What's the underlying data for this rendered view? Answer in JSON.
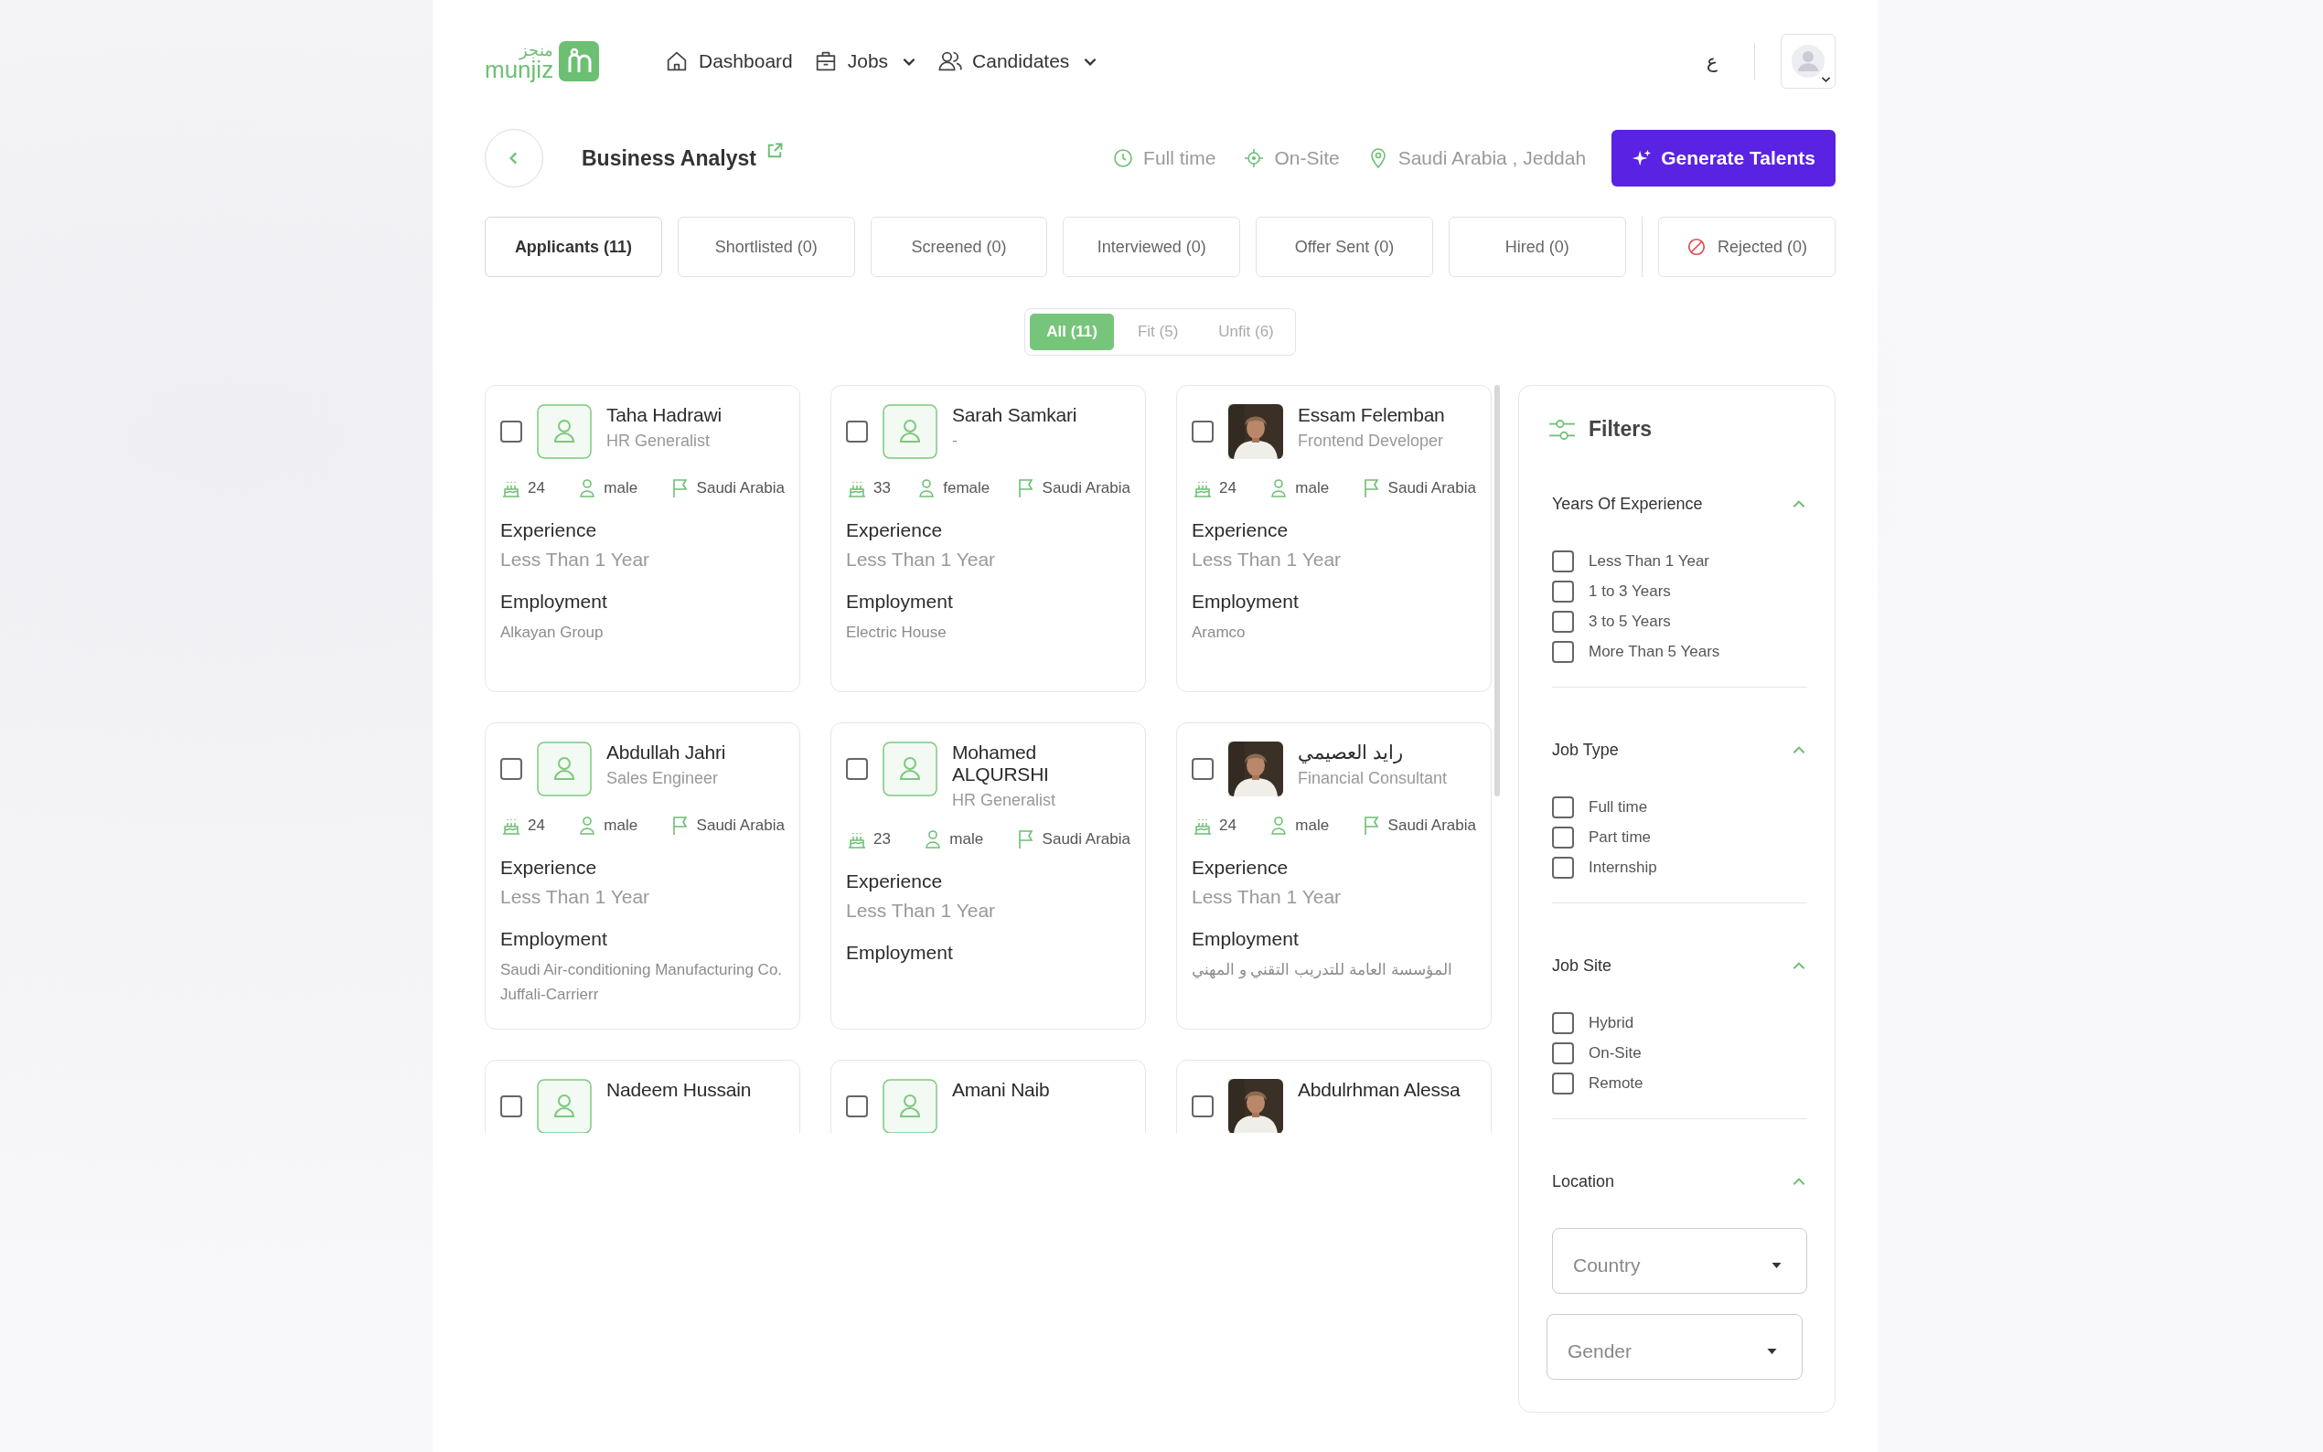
{
  "logo": {
    "wordmark": "munjiz",
    "arabic_wordmark": "منجز"
  },
  "nav": [
    {
      "label": "Dashboard",
      "kind": "home",
      "dropdown": false
    },
    {
      "label": "Jobs",
      "kind": "briefcase",
      "dropdown": true
    },
    {
      "label": "Candidates",
      "kind": "users",
      "dropdown": true
    }
  ],
  "language_toggle": "ع",
  "job": {
    "title": "Business Analyst",
    "meta": [
      {
        "kind": "clock",
        "text": "Full time"
      },
      {
        "kind": "site",
        "text": "On-Site"
      },
      {
        "kind": "location",
        "text": "Saudi Arabia , Jeddah"
      }
    ],
    "action": "Generate Talents"
  },
  "stage_tabs": [
    {
      "label": "Applicants (11)",
      "selected": true,
      "kind": "stage"
    },
    {
      "label": "Shortlisted (0)",
      "selected": false,
      "kind": "stage"
    },
    {
      "label": "Screened (0)",
      "selected": false,
      "kind": "stage"
    },
    {
      "label": "Interviewed (0)",
      "selected": false,
      "kind": "stage"
    },
    {
      "label": "Offer Sent (0)",
      "selected": false,
      "kind": "stage"
    },
    {
      "label": "Hired (0)",
      "selected": false,
      "kind": "stage"
    },
    {
      "label": "Rejected (0)",
      "selected": false,
      "kind": "rejected"
    }
  ],
  "fit_filter": [
    {
      "label": "All (11)",
      "selected": true
    },
    {
      "label": "Fit (5)",
      "selected": false
    },
    {
      "label": "Unfit (6)",
      "selected": false
    }
  ],
  "candidates": [
    {
      "name": "Taha Hadrawi",
      "title": "HR Generalist",
      "kind": "placeholder",
      "checked": false,
      "age": "24",
      "gender": "male",
      "country": "Saudi Arabia",
      "experience_label": "Experience",
      "experience": "Less Than 1 Year",
      "employment_label": "Employment",
      "employment": "Alkayan Group"
    },
    {
      "name": "Sarah Samkari",
      "title": "-",
      "kind": "placeholder",
      "checked": false,
      "age": "33",
      "gender": "female",
      "country": "Saudi Arabia",
      "experience_label": "Experience",
      "experience": "Less Than 1 Year",
      "employment_label": "Employment",
      "employment": "Electric House"
    },
    {
      "name": "Essam Felemban",
      "title": "Frontend Developer",
      "checked": false,
      "age": "24",
      "gender": "male",
      "country": "Saudi Arabia",
      "experience_label": "Experience",
      "experience": "Less Than 1 Year",
      "employment_label": "Employment",
      "employment": "Aramco"
    },
    {
      "name": "Abdullah Jahri",
      "title": "Sales Engineer",
      "kind": "placeholder",
      "checked": false,
      "age": "24",
      "gender": "male",
      "country": "Saudi Arabia",
      "experience_label": "Experience",
      "experience": "Less Than 1 Year",
      "employment_label": "Employment",
      "employment": "Saudi Air-conditioning Manufacturing Co. Juffali-Carrierr"
    },
    {
      "name": "Mohamed ALQURSHI",
      "title": "HR Generalist",
      "kind": "placeholder",
      "checked": false,
      "age": "23",
      "gender": "male",
      "country": "Saudi Arabia",
      "experience_label": "Experience",
      "experience": "Less Than 1 Year",
      "employment_label": "Employment"
    },
    {
      "name": "رايد العصيمي",
      "title": "Financial Consultant",
      "checked": false,
      "age": "24",
      "gender": "male",
      "country": "Saudi Arabia",
      "experience_label": "Experience",
      "experience": "Less Than 1 Year",
      "employment_label": "Employment",
      "employment": "المؤسسة العامة للتدريب التقني و المهني"
    },
    {
      "name": "Nadeem Hussain",
      "kind": "placeholder",
      "checked": false
    },
    {
      "name": "Amani Naib",
      "kind": "placeholder",
      "checked": false
    },
    {
      "name": "Abdulrhman Alessa",
      "checked": false
    }
  ],
  "filters": {
    "title": "Filters",
    "sections": [
      {
        "title": "Years Of Experience",
        "expanded": true,
        "kind": "checkboxes",
        "options": [
          {
            "label": "Less Than 1 Year",
            "checked": false
          },
          {
            "label": "1 to 3 Years",
            "checked": false
          },
          {
            "label": "3 to 5 Years",
            "checked": false
          },
          {
            "label": "More Than 5 Years",
            "checked": false
          }
        ]
      },
      {
        "title": "Job Type",
        "expanded": true,
        "kind": "checkboxes",
        "options": [
          {
            "label": "Full time",
            "checked": false
          },
          {
            "label": "Part time",
            "checked": false
          },
          {
            "label": "Internship",
            "checked": false
          }
        ]
      },
      {
        "title": "Job Site",
        "expanded": true,
        "kind": "checkboxes",
        "options": [
          {
            "label": "Hybrid",
            "checked": false
          },
          {
            "label": "On-Site",
            "checked": false
          },
          {
            "label": "Remote",
            "checked": false
          }
        ]
      },
      {
        "title": "Location",
        "expanded": true,
        "kind": "dropdowns",
        "dropdowns": [
          {
            "placeholder": "Country"
          },
          {
            "placeholder": "Gender"
          }
        ]
      }
    ]
  }
}
